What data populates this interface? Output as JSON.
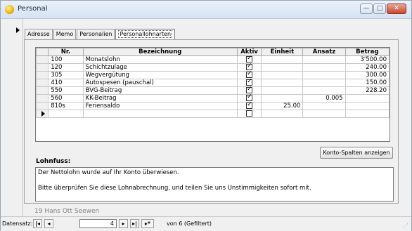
{
  "window": {
    "title": "Personal"
  },
  "tabs": [
    {
      "label": "Adresse"
    },
    {
      "label": "Memo"
    },
    {
      "label": "Personalien"
    },
    {
      "label": "Personallohnarten"
    }
  ],
  "grid": {
    "headers": [
      "Nr.",
      "Bezeichnung",
      "Aktiv",
      "Einheit",
      "Ansatz",
      "Betrag"
    ],
    "rows": [
      {
        "nr": "100",
        "bezeichnung": "Monatslohn",
        "aktiv": true,
        "einheit": "",
        "ansatz": "",
        "betrag": "3'500.00"
      },
      {
        "nr": "120",
        "bezeichnung": "Schichtzulage",
        "aktiv": true,
        "einheit": "",
        "ansatz": "",
        "betrag": "240.00"
      },
      {
        "nr": "305",
        "bezeichnung": "Wegvergütung",
        "aktiv": true,
        "einheit": "",
        "ansatz": "",
        "betrag": "300.00"
      },
      {
        "nr": "410",
        "bezeichnung": "Autospesen (pauschal)",
        "aktiv": true,
        "einheit": "",
        "ansatz": "",
        "betrag": "150.00"
      },
      {
        "nr": "550",
        "bezeichnung": "BVG-Beitrag",
        "aktiv": true,
        "einheit": "",
        "ansatz": "",
        "betrag": "228.20"
      },
      {
        "nr": "560",
        "bezeichnung": "KK-Beitrag",
        "aktiv": true,
        "einheit": "",
        "ansatz": "0.005",
        "betrag": ""
      },
      {
        "nr": "810s",
        "bezeichnung": "Feriensaldo",
        "aktiv": true,
        "einheit": "25.00",
        "ansatz": "",
        "betrag": ""
      }
    ]
  },
  "konto_button": "Konto-Spalten anzeigen",
  "lohnfuss": {
    "label": "Lohnfuss:",
    "line1": "Der Nettolohn wurde auf Ihr Konto überwiesen.",
    "line2": "Bitte überprüfen Sie diese Lohnabrechnung, und teilen Sie uns Unstimmigkeiten sofort mit."
  },
  "employee": "19 Hans Ott Seewen",
  "navigator": {
    "label": "Datensatz:",
    "current": "4",
    "total": "von 6 (Gefiltert)"
  }
}
